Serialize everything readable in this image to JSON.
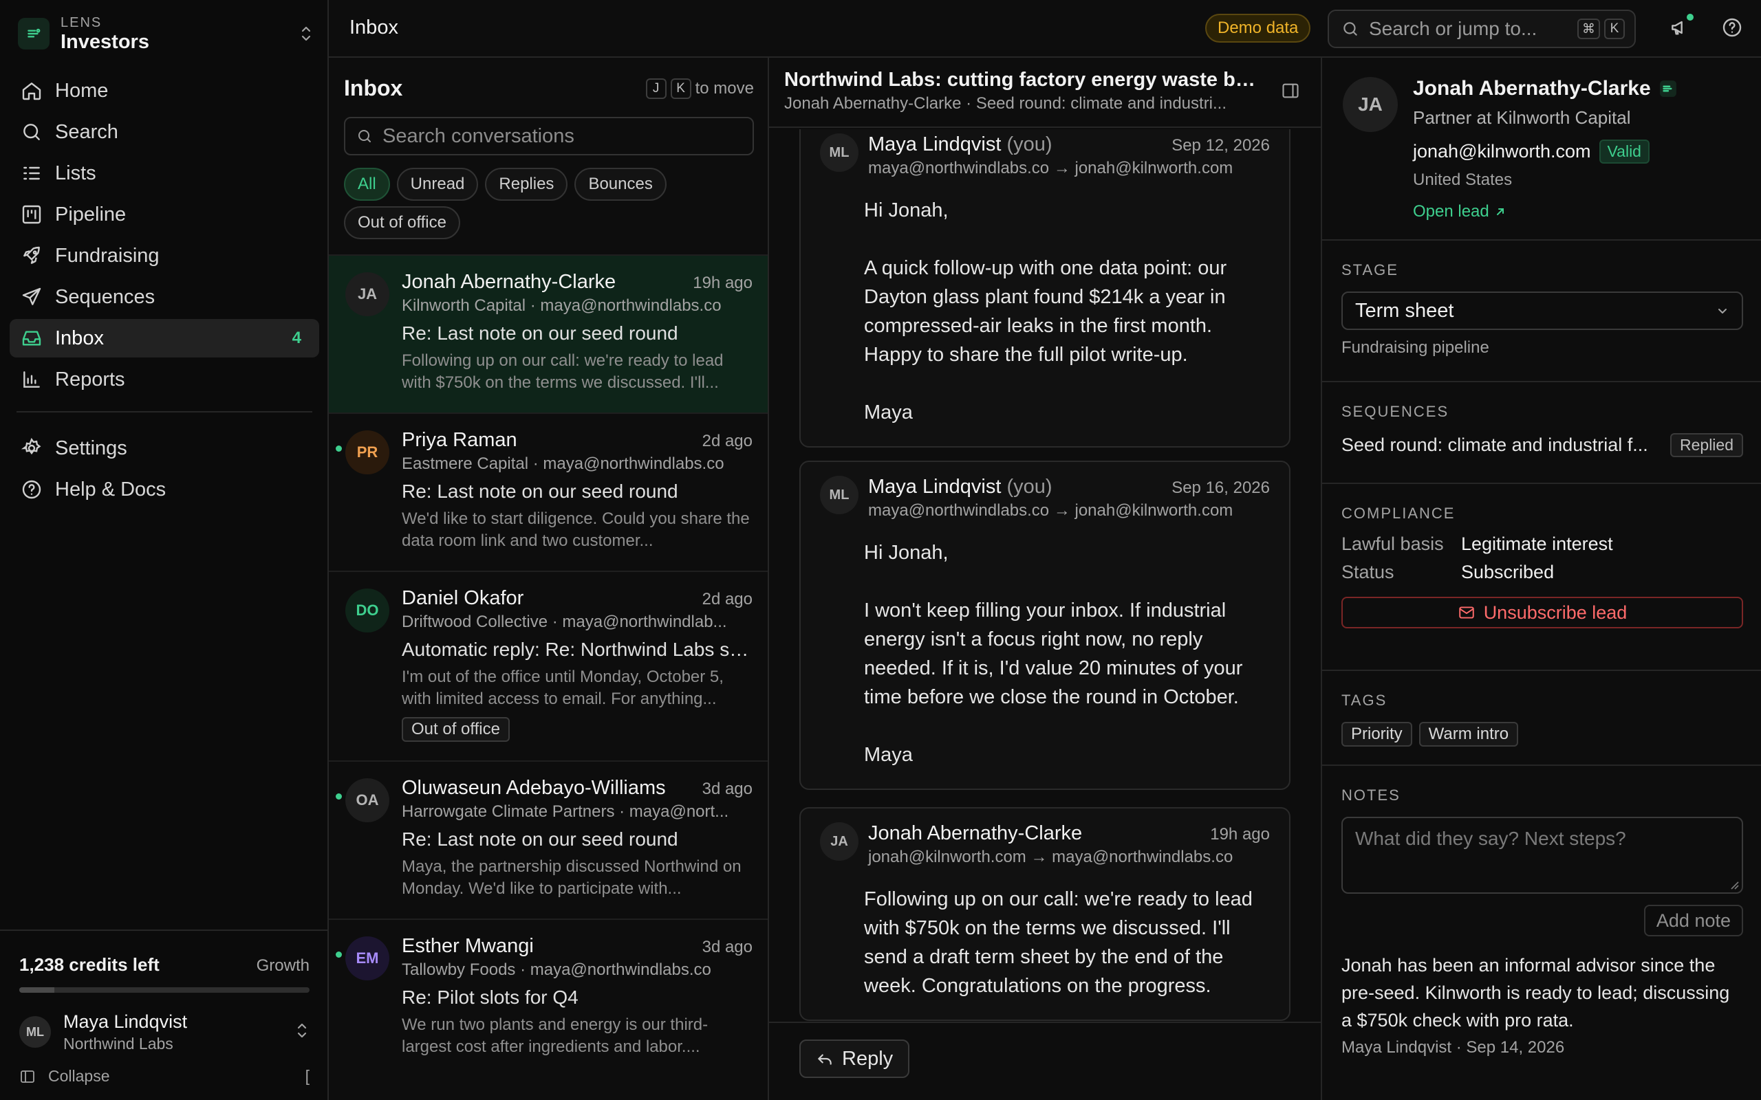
{
  "colors": {
    "accent": "#3ecf8e",
    "danger": "#ff6b6b",
    "warning": "#f0b429",
    "background": "#0d0d0d"
  },
  "brand": {
    "kicker": "LENS",
    "workspace": "Investors"
  },
  "nav": {
    "items": [
      {
        "label": "Home",
        "icon": "home-icon"
      },
      {
        "label": "Search",
        "icon": "search-icon"
      },
      {
        "label": "Lists",
        "icon": "list-icon"
      },
      {
        "label": "Pipeline",
        "icon": "kanban-icon"
      },
      {
        "label": "Fundraising",
        "icon": "rocket-icon"
      },
      {
        "label": "Sequences",
        "icon": "send-icon"
      },
      {
        "label": "Inbox",
        "icon": "inbox-icon",
        "count": "4",
        "active": true
      },
      {
        "label": "Reports",
        "icon": "bar-chart-icon"
      }
    ],
    "secondary": [
      {
        "label": "Settings",
        "icon": "gear-icon"
      },
      {
        "label": "Help & Docs",
        "icon": "help-icon"
      }
    ]
  },
  "account": {
    "credits": "1,238 credits left",
    "plan": "Growth",
    "credit_fraction": 0.12,
    "initials": "ML",
    "name": "Maya Lindqvist",
    "org": "Northwind Labs",
    "collapse": "Collapse",
    "collapse_key": "["
  },
  "topbar": {
    "title": "Inbox",
    "demo_badge": "Demo data",
    "search_placeholder": "Search or jump to...",
    "kbd_cmd": "⌘",
    "kbd_k": "K"
  },
  "list": {
    "title": "Inbox",
    "kbd_j": "J",
    "kbd_k": "K",
    "move_hint": "to move",
    "search_placeholder": "Search conversations",
    "filters": [
      "All",
      "Unread",
      "Replies",
      "Bounces",
      "Out of office"
    ],
    "conversations": [
      {
        "initials": "JA",
        "name": "Jonah Abernathy-Clarke",
        "time": "19h ago",
        "meta": "Kilnworth Capital · maya@northwindlabs.co",
        "subject": "Re: Last note on our seed round",
        "snippet": "Following up on our call: we're ready to lead with $750k on the terms we discussed. I'll...",
        "unread": false,
        "selected": true,
        "tag": ""
      },
      {
        "initials": "PR",
        "name": "Priya Raman",
        "time": "2d ago",
        "meta": "Eastmere Capital · maya@northwindlabs.co",
        "subject": "Re: Last note on our seed round",
        "snippet": "We'd like to start diligence. Could you share the data room link and two customer...",
        "unread": true,
        "selected": false,
        "tag": ""
      },
      {
        "initials": "DO",
        "name": "Daniel Okafor",
        "time": "2d ago",
        "meta": "Driftwood Collective · maya@northwindlab...",
        "subject": "Automatic reply: Re: Northwind Labs se...",
        "snippet": "I'm out of the office until Monday, October 5, with limited access to email. For anything...",
        "unread": false,
        "selected": false,
        "tag": "Out of office"
      },
      {
        "initials": "OA",
        "name": "Oluwaseun Adebayo-Williams",
        "time": "3d ago",
        "meta": "Harrowgate Climate Partners · maya@nort...",
        "subject": "Re: Last note on our seed round",
        "snippet": "Maya, the partnership discussed Northwind on Monday. We'd like to participate with...",
        "unread": true,
        "selected": false,
        "tag": ""
      },
      {
        "initials": "EM",
        "name": "Esther Mwangi",
        "time": "3d ago",
        "meta": "Tallowby Foods · maya@northwindlabs.co",
        "subject": "Re: Pilot slots for Q4",
        "snippet": "We run two plants and energy is our third-largest cost after ingredients and labor....",
        "unread": true,
        "selected": false,
        "tag": ""
      }
    ]
  },
  "thread": {
    "subject": "Northwind Labs: cutting factory energy waste by ...",
    "sub": "Jonah Abernathy-Clarke · Seed round: climate and industri...",
    "messages": [
      {
        "initials": "ML",
        "from": "Maya Lindqvist",
        "you": "(you)",
        "date": "Sep 12, 2026",
        "route": "maya@northwindlabs.co → jonah@kilnworth.com",
        "paragraphs": [
          "Hi Jonah,",
          "A quick follow-up with one data point: our Dayton glass plant found $214k a year in compressed-air leaks in the first month. Happy to share the full pilot write-up.",
          "Maya"
        ]
      },
      {
        "initials": "ML",
        "from": "Maya Lindqvist",
        "you": "(you)",
        "date": "Sep 16, 2026",
        "route": "maya@northwindlabs.co → jonah@kilnworth.com",
        "paragraphs": [
          "Hi Jonah,",
          "I won't keep filling your inbox. If industrial energy isn't a focus right now, no reply needed. If it is, I'd value 20 minutes of your time before we close the round in October.",
          "Maya"
        ]
      },
      {
        "initials": "JA",
        "from": "Jonah Abernathy-Clarke",
        "you": "",
        "date": "19h ago",
        "route": "jonah@kilnworth.com → maya@northwindlabs.co",
        "paragraphs": [
          "Following up on our call: we're ready to lead with $750k on the terms we discussed. I'll send a draft term sheet by the end of the week. Congratulations on the progress."
        ]
      }
    ],
    "reply_label": "Reply"
  },
  "lead": {
    "initials": "JA",
    "name": "Jonah Abernathy-Clarke",
    "title": "Partner at Kilnworth Capital",
    "email": "jonah@kilnworth.com",
    "email_status": "Valid",
    "country": "United States",
    "open_lead": "Open lead",
    "stage_label": "STAGE",
    "stage_value": "Term sheet",
    "stage_hint": "Fundraising pipeline",
    "sequences_label": "SEQUENCES",
    "sequence_name": "Seed round: climate and industrial f...",
    "sequence_status": "Replied",
    "compliance_label": "COMPLIANCE",
    "lawful_basis_key": "Lawful basis",
    "lawful_basis_val": "Legitimate interest",
    "status_key": "Status",
    "status_val": "Subscribed",
    "unsubscribe": "Unsubscribe lead",
    "tags_label": "TAGS",
    "tags": [
      "Priority",
      "Warm intro"
    ],
    "notes_label": "NOTES",
    "notes_placeholder": "What did they say? Next steps?",
    "add_note": "Add note",
    "note_text": "Jonah has been an informal advisor since the pre-seed. Kilnworth is ready to lead; discussing a $750k check with pro rata.",
    "note_meta": "Maya Lindqvist · Sep 14, 2026"
  }
}
